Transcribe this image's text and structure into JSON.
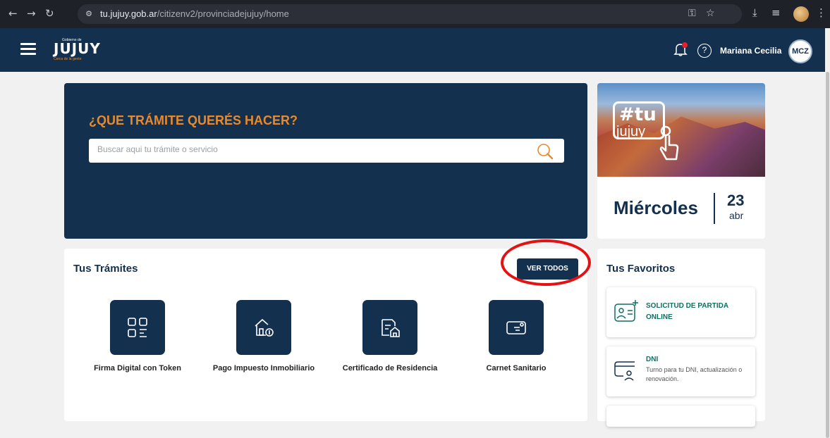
{
  "browser": {
    "url_host": "tu.jujuy.gob.ar",
    "url_path": "/citizenv2/provinciadejujuy/home"
  },
  "header": {
    "logo_small": "Gobierno de",
    "logo_big": "JUJUY",
    "logo_tagline": "Cerca de la gente",
    "help_icon": "?",
    "user_name": "Mariana Cecilia",
    "user_initials": "MCZ"
  },
  "hero": {
    "title": "¿QUE TRÁMITE QUERÉS HACER?",
    "search_placeholder": "Buscar aqui tu trámite o servicio"
  },
  "date_card": {
    "banner_hash": "#tu",
    "banner_text": "jujuy",
    "weekday": "Miércoles",
    "day": "23",
    "month": "abr"
  },
  "tramites": {
    "title": "Tus Trámites",
    "ver_todos": "VER TODOS",
    "items": [
      {
        "label": "Firma Digital con Token",
        "icon": "qr-token-icon"
      },
      {
        "label": "Pago Impuesto Inmobiliario",
        "icon": "house-payment-icon"
      },
      {
        "label": "Certificado de Residencia",
        "icon": "residence-certificate-icon"
      },
      {
        "label": "Carnet Sanitario",
        "icon": "health-card-icon"
      }
    ]
  },
  "favoritos": {
    "title": "Tus Favoritos",
    "items": [
      {
        "title_line1": "SOLICITUD DE PARTIDA",
        "title_line2": "ONLINE",
        "icon": "id-add-icon"
      },
      {
        "title": "DNI",
        "subtitle": "Turno para tu DNI, actualización o renovación.",
        "icon": "dni-card-icon"
      }
    ]
  },
  "colors": {
    "navy": "#14304f",
    "orange": "#e88a2b",
    "teal": "#0f6f62",
    "annotation_red": "#e41313"
  }
}
